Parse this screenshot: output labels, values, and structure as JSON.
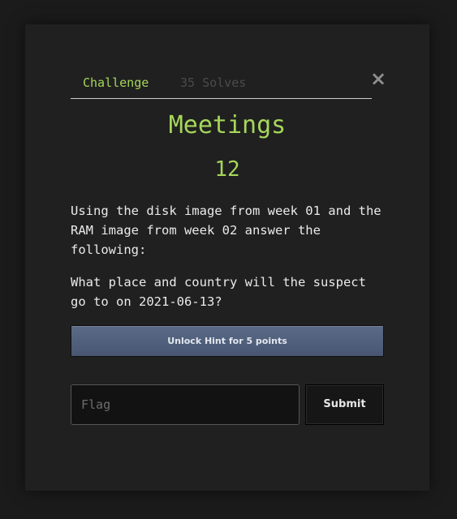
{
  "tabs": {
    "challenge": "Challenge",
    "solves": "35 Solves"
  },
  "close_icon": "×",
  "challenge": {
    "title": "Meetings",
    "points": "12",
    "description": [
      "Using the disk image from week 01 and the RAM image from week 02 answer the following:",
      "What place and country will the suspect go to on 2021-06-13?"
    ]
  },
  "hint_button": "Unlock Hint for 5 points",
  "flag_input": {
    "placeholder": "Flag",
    "value": ""
  },
  "submit_button": "Submit",
  "colors": {
    "accent": "#a6d65a",
    "background": "#1b1b1b",
    "modal": "#202020",
    "hint_button": "#53627f"
  }
}
